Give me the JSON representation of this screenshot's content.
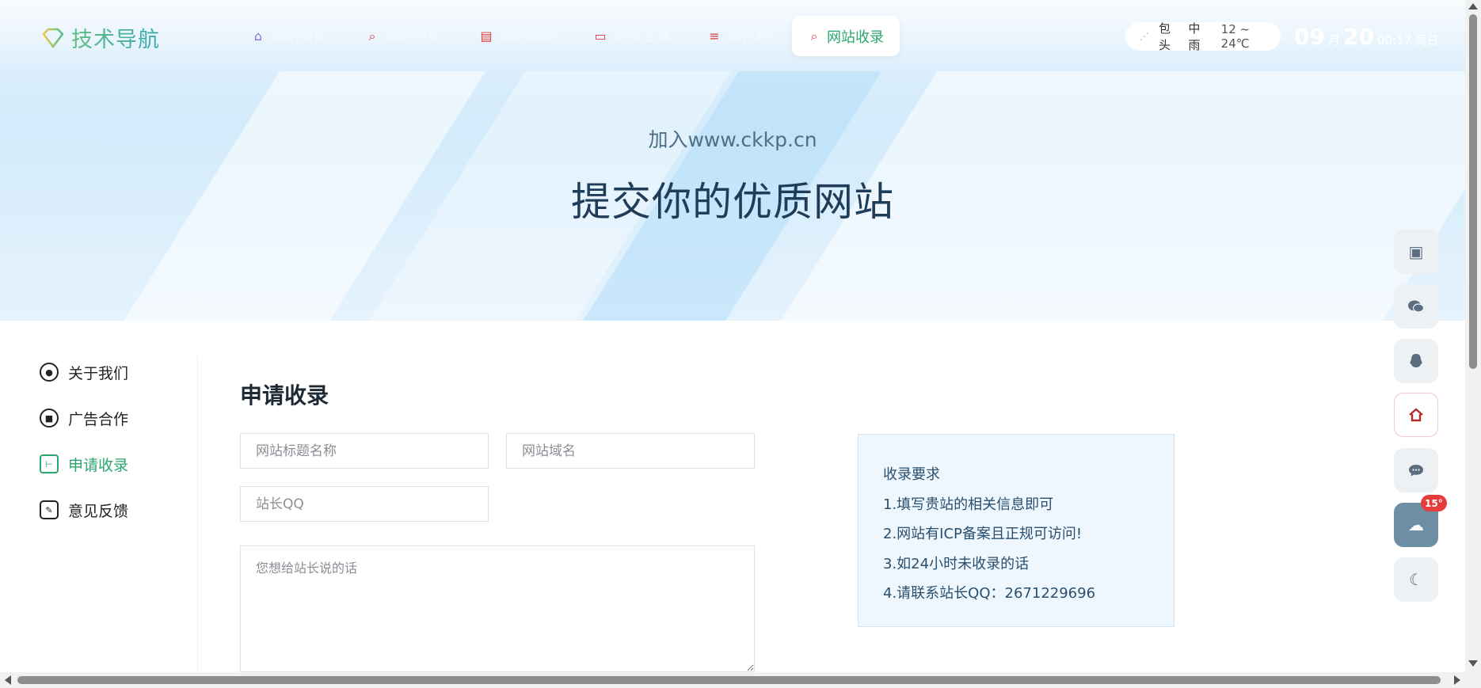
{
  "header": {
    "logo_text": "技术导航",
    "nav": [
      {
        "label": "网站首页",
        "icon": "home-icon",
        "glyph": "⌂",
        "color": "#8b6fd6"
      },
      {
        "label": "最近更新",
        "icon": "search-icon",
        "glyph": "⌕",
        "color": "#d83c3c"
      },
      {
        "label": "导航网址",
        "icon": "document-icon",
        "glyph": "▤",
        "color": "#d83c3c"
      },
      {
        "label": "站长工具",
        "icon": "browser-icon",
        "glyph": "▭",
        "color": "#d83c3c"
      },
      {
        "label": "排行榜",
        "icon": "list-icon",
        "glyph": "≡",
        "color": "#d83c3c"
      },
      {
        "label": "网站收录",
        "icon": "search-icon",
        "glyph": "⌕",
        "color": "#d83c3c",
        "active": true
      }
    ],
    "weather": {
      "city": "包头",
      "condition": "中雨",
      "temp": "12 ~ 24℃"
    },
    "datetime": {
      "month": "09",
      "month_unit": "月",
      "day": "20",
      "time": "00:17",
      "weekday": "周日"
    }
  },
  "hero": {
    "subtitle": "加入www.ckkp.cn",
    "title": "提交你的优质网站"
  },
  "sidebar": {
    "items": [
      {
        "label": "关于我们",
        "icon": "drop-icon",
        "glyph": "●"
      },
      {
        "label": "广告合作",
        "icon": "stop-icon",
        "glyph": "■"
      },
      {
        "label": "申请收录",
        "icon": "apply-icon",
        "glyph": "⊢",
        "active": true
      },
      {
        "label": "意见反馈",
        "icon": "edit-icon",
        "glyph": "✎"
      }
    ]
  },
  "form": {
    "title": "申请收录",
    "site_name_placeholder": "网站标题名称",
    "site_domain_placeholder": "网站域名",
    "qq_placeholder": "站长QQ",
    "message_placeholder": "您想给站长说的话"
  },
  "requirements": {
    "title": "收录要求",
    "items": [
      "1.填写贵站的相关信息即可",
      "2.网站有ICP备案且正规可访问!",
      "3.如24小时未收录的话",
      "4.请联系站长QQ：2671229696"
    ]
  },
  "floating": {
    "weather_badge": "15°"
  }
}
